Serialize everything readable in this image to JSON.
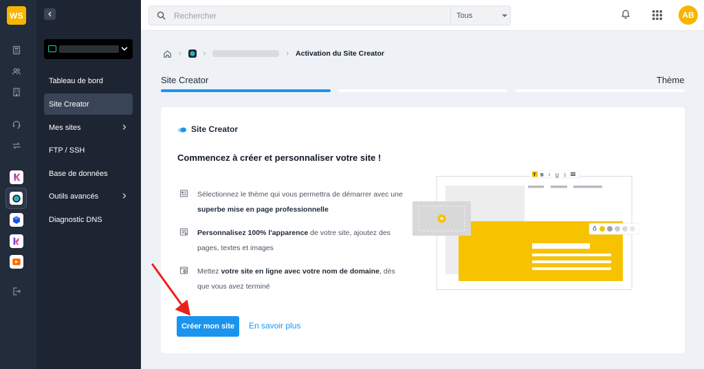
{
  "brand": {
    "initials": "WS",
    "color": "#f7b500"
  },
  "rail": {
    "icons": [
      "calculator-icon",
      "users-icon",
      "building-icon",
      "headset-icon",
      "transfer-icon"
    ],
    "apps": [
      "kchat-app-icon",
      "site-creator-app-icon",
      "kdrive-app-icon",
      "kmail-app-icon",
      "kmeet-app-icon"
    ],
    "logout_icon": "logout-icon"
  },
  "sidebar": {
    "collapse_icon": "chevron-left-icon",
    "account_name": "",
    "items": [
      {
        "label": "Tableau de bord",
        "active": false,
        "has_chevron": false
      },
      {
        "label": "Site Creator",
        "active": true,
        "has_chevron": false
      },
      {
        "label": "Mes sites",
        "active": false,
        "has_chevron": true
      },
      {
        "label": "FTP / SSH",
        "active": false,
        "has_chevron": false
      },
      {
        "label": "Base de données",
        "active": false,
        "has_chevron": false
      },
      {
        "label": "Outils avancés",
        "active": false,
        "has_chevron": true
      },
      {
        "label": "Diagnostic DNS",
        "active": false,
        "has_chevron": false
      }
    ]
  },
  "topbar": {
    "search_placeholder": "Rechercher",
    "scope": "Tous",
    "avatar_initials": "AB",
    "avatar_color": "#f7b500"
  },
  "breadcrumb": {
    "current": "Activation du Site Creator"
  },
  "stepper": {
    "steps": [
      {
        "label": "Site Creator",
        "done": true
      },
      {
        "label": "",
        "done": false
      },
      {
        "label": "Thème",
        "done": false
      }
    ]
  },
  "card": {
    "title": "Site Creator",
    "heading": "Commencez à créer et personnaliser votre site !",
    "bullets": [
      {
        "icon": "theme-icon",
        "pre": "Sélectionnez le thème qui vous permettra de démarrer avec une ",
        "strong": "superbe mise en page professionnelle",
        "post": ""
      },
      {
        "icon": "customize-icon",
        "pre": "",
        "strong": "Personnalisez 100% l'apparence",
        "post": " de votre site, ajoutez des pages, textes et images"
      },
      {
        "icon": "publish-icon",
        "pre": "Mettez ",
        "strong": "votre site en ligne avec votre nom de domaine",
        "post": ", dès que vous avez terminé"
      }
    ],
    "cta_label": "Créer mon site",
    "learn_more": "En savoir plus"
  },
  "colors": {
    "accent": "#1a94ef",
    "rail_bg": "#232c3b",
    "sidebar_bg": "#1d2532",
    "illustration_yellow": "#f7c200",
    "annotation_arrow": "#e8221b"
  }
}
